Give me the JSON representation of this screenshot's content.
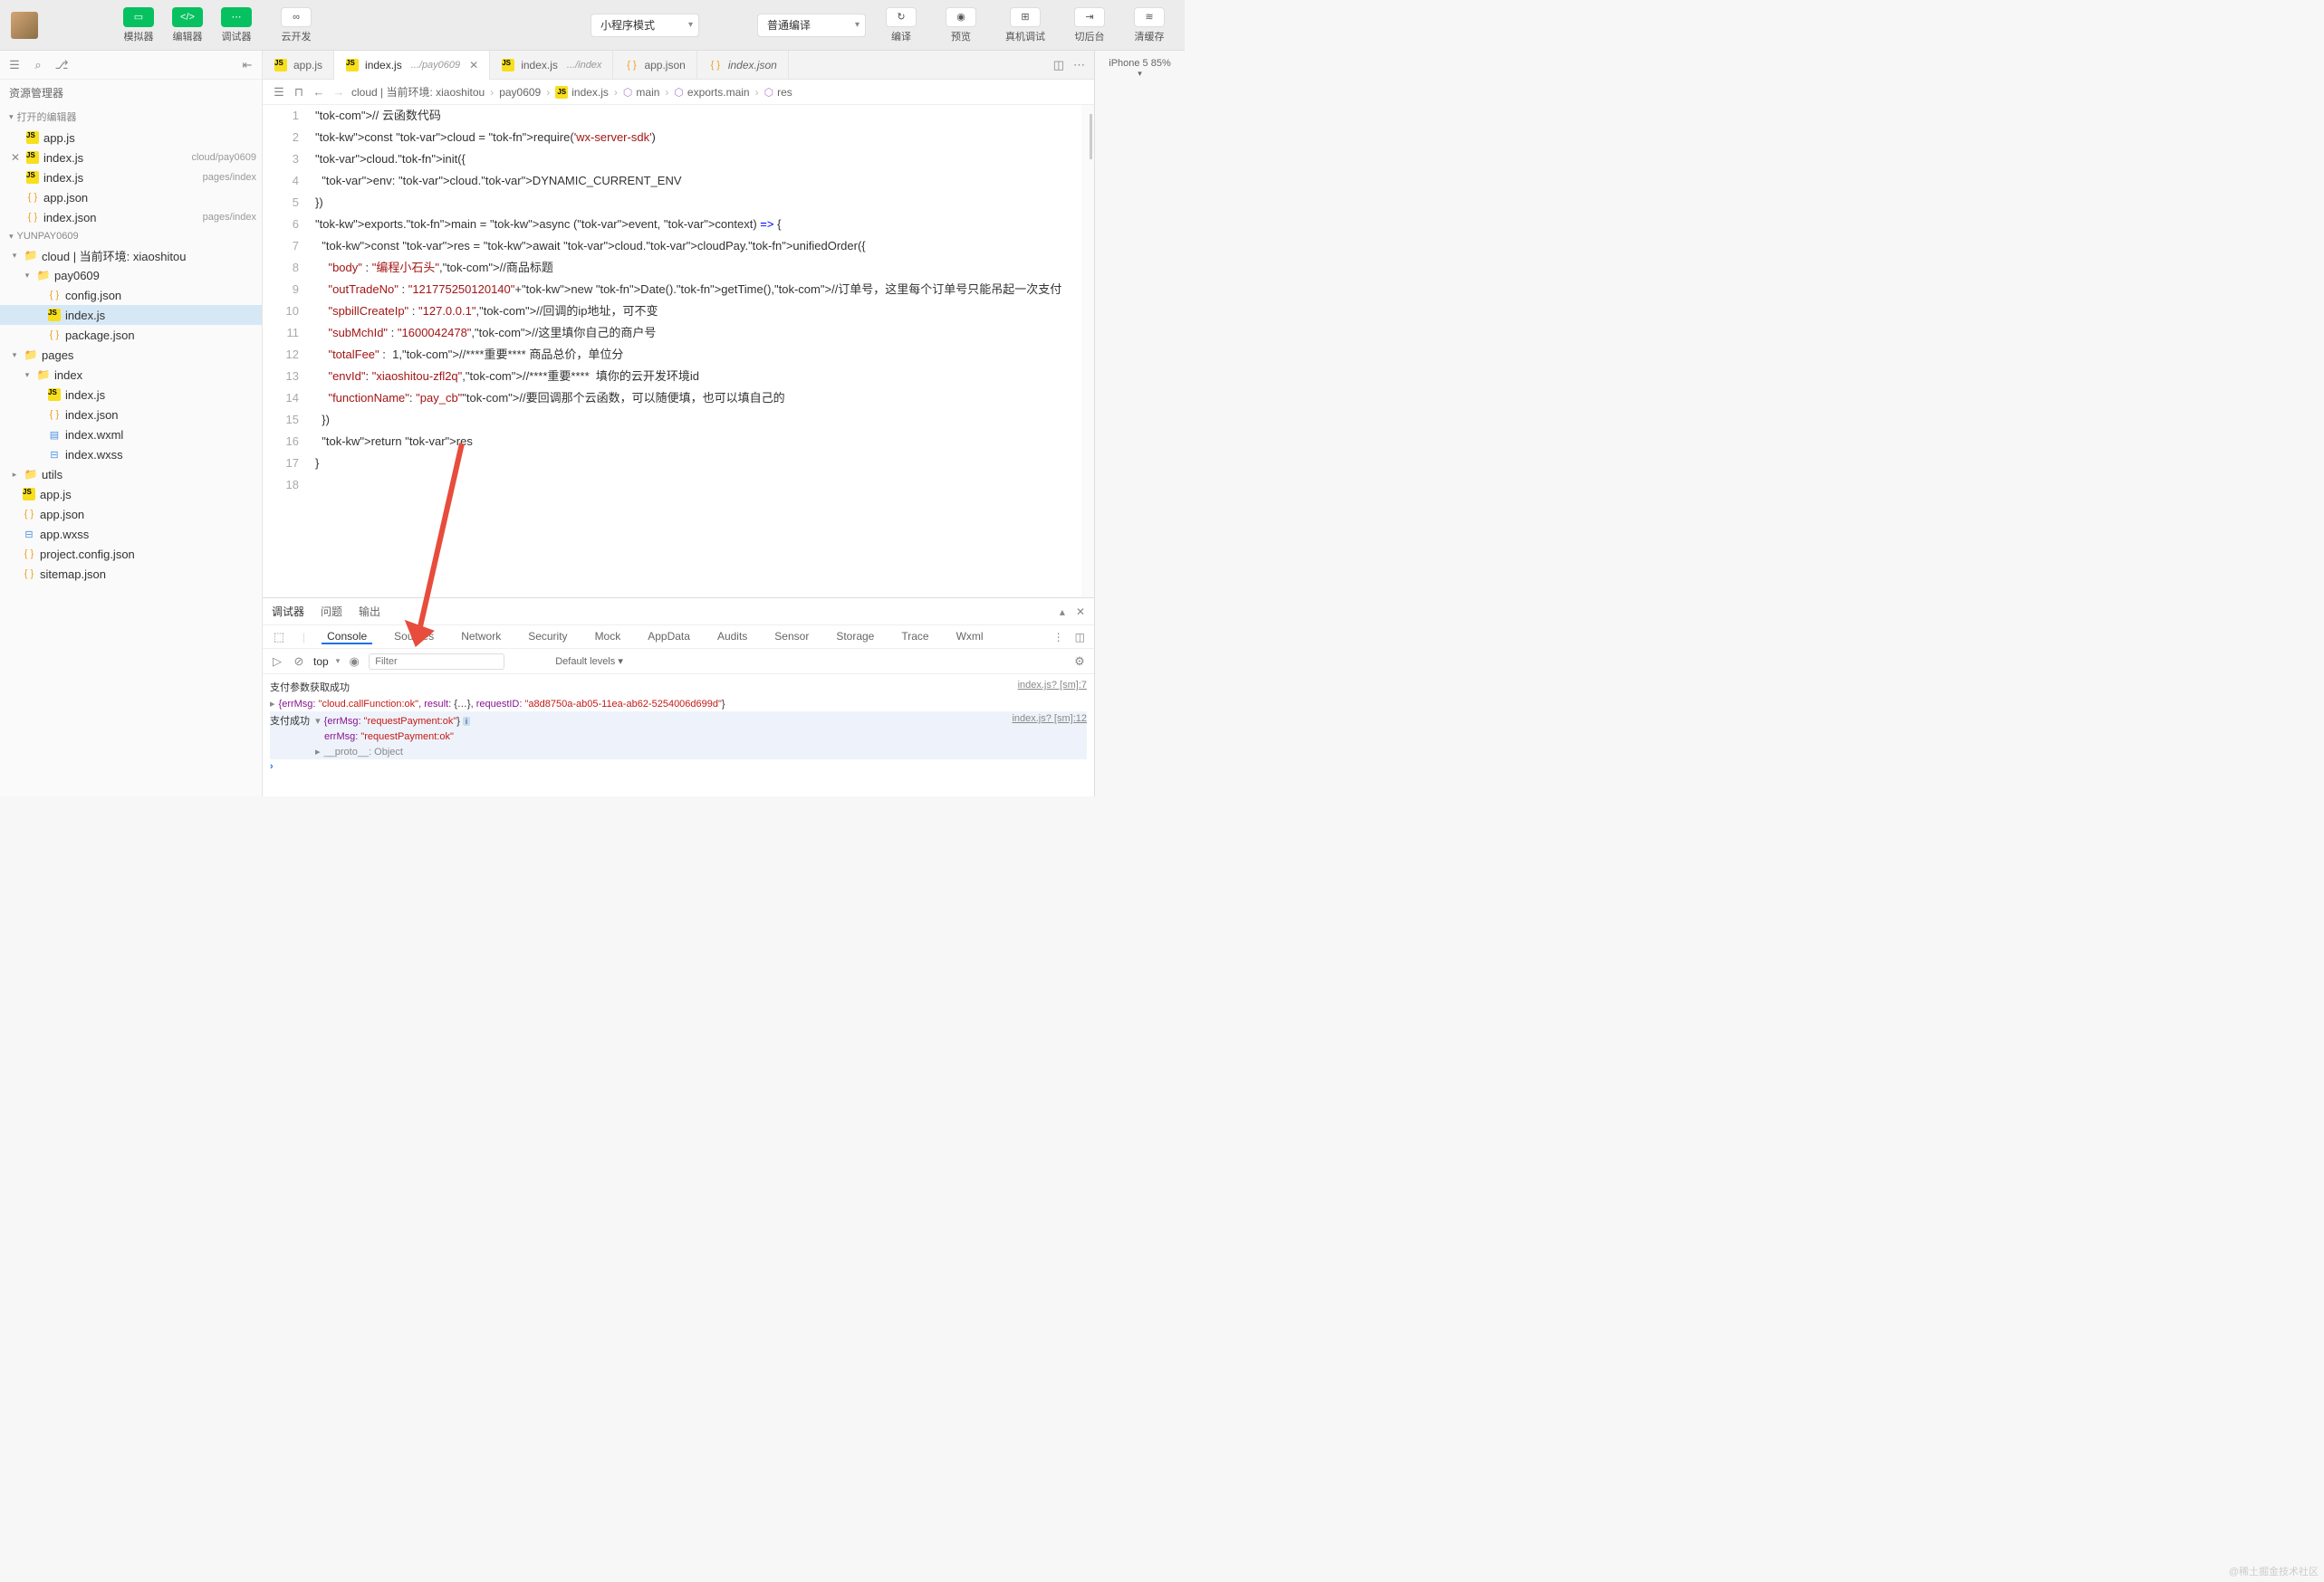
{
  "toolbar": {
    "simulator": "模拟器",
    "editor": "编辑器",
    "debugger": "调试器",
    "cloud": "云开发",
    "mode": "小程序模式",
    "compile": "普通编译",
    "build": "编译",
    "preview": "预览",
    "remote": "真机调试",
    "switch": "切后台",
    "cache": "清缓存"
  },
  "preview_status": "iPhone 5 85%",
  "sidebar": {
    "title": "资源管理器",
    "open_editors": "打开的编辑器",
    "open_files": [
      {
        "icon": "js",
        "name": "app.js",
        "sub": ""
      },
      {
        "icon": "js",
        "name": "index.js",
        "sub": "cloud/pay0609",
        "close": true
      },
      {
        "icon": "js",
        "name": "index.js",
        "sub": "pages/index"
      },
      {
        "icon": "json",
        "name": "app.json",
        "sub": ""
      },
      {
        "icon": "json",
        "name": "index.json",
        "sub": "pages/index"
      }
    ],
    "project_name": "YUNPAY0609",
    "tree": {
      "cloud": {
        "label": "cloud | 当前环境: xiaoshitou",
        "children": {
          "pay0609": {
            "label": "pay0609",
            "children": [
              {
                "icon": "json",
                "name": "config.json"
              },
              {
                "icon": "js",
                "name": "index.js",
                "sel": true
              },
              {
                "icon": "json",
                "name": "package.json"
              }
            ]
          }
        }
      },
      "pages": {
        "label": "pages",
        "children": {
          "index": {
            "label": "index",
            "children": [
              {
                "icon": "js",
                "name": "index.js"
              },
              {
                "icon": "json",
                "name": "index.json"
              },
              {
                "icon": "wxml",
                "name": "index.wxml"
              },
              {
                "icon": "wxss",
                "name": "index.wxss"
              }
            ]
          }
        }
      },
      "utils": {
        "label": "utils"
      },
      "root_files": [
        {
          "icon": "js",
          "name": "app.js"
        },
        {
          "icon": "json",
          "name": "app.json"
        },
        {
          "icon": "wxss",
          "name": "app.wxss"
        },
        {
          "icon": "json",
          "name": "project.config.json"
        },
        {
          "icon": "json",
          "name": "sitemap.json"
        }
      ]
    }
  },
  "tabs": [
    {
      "icon": "js",
      "label": "app.js"
    },
    {
      "icon": "js",
      "label": "index.js",
      "sub": ".../pay0609",
      "active": true,
      "close": true
    },
    {
      "icon": "js",
      "label": "index.js",
      "sub": ".../index"
    },
    {
      "icon": "json",
      "label": "app.json"
    },
    {
      "icon": "json",
      "label": "index.json",
      "italic": true
    }
  ],
  "breadcrumb": {
    "parts": [
      "cloud | 当前环境: xiaoshitou",
      "pay0609",
      "index.js",
      "main",
      "exports.main",
      "res"
    ]
  },
  "code_lines": [
    "// 云函数代码",
    "const cloud = require('wx-server-sdk')",
    "cloud.init({",
    "  env: cloud.DYNAMIC_CURRENT_ENV",
    "})",
    "exports.main = async (event, context) => {",
    "  const res = await cloud.cloudPay.unifiedOrder({",
    "    \"body\" : \"编程小石头\",//商品标题",
    "    \"outTradeNo\" : \"121775250120140\"+new Date().getTime(),//订单号，这里每个订单号只能吊起一次支付",
    "    \"spbillCreateIp\" : \"127.0.0.1\",//回调的ip地址，可不变",
    "    \"subMchId\" : \"1600042478\",//这里填你自己的商户号",
    "    \"totalFee\" :  1,//****重要**** 商品总价，单位分",
    "    \"envId\": \"xiaoshitou-zfl2q\",//****重要****  填你的云开发环境id",
    "    \"functionName\": \"pay_cb\"//要回调那个云函数，可以随便填，也可以填自己的",
    "  })",
    "  return res",
    "}",
    ""
  ],
  "debug": {
    "tabs": [
      "调试器",
      "问题",
      "输出"
    ],
    "subtabs": [
      "Console",
      "Sources",
      "Network",
      "Security",
      "Mock",
      "AppData",
      "Audits",
      "Sensor",
      "Storage",
      "Trace",
      "Wxml"
    ],
    "context": "top",
    "filter_ph": "Filter",
    "levels": "Default levels",
    "console": {
      "line1_text": "支付参数获取成功",
      "line1_src": "index.js? [sm]:7",
      "line1_obj": "{errMsg: \"cloud.callFunction:ok\", result: {…}, requestID: \"a8d8750a-ab05-11ea-ab62-5254006d699d\"}",
      "line2_text": "支付成功",
      "line2_src": "index.js? [sm]:12",
      "line2_obj": "{errMsg: \"requestPayment:ok\"}",
      "line2_detail_key": "errMsg:",
      "line2_detail_val": "\"requestPayment:ok\"",
      "line2_proto": "__proto__: Object"
    }
  },
  "watermark": "@稀土掘金技术社区"
}
